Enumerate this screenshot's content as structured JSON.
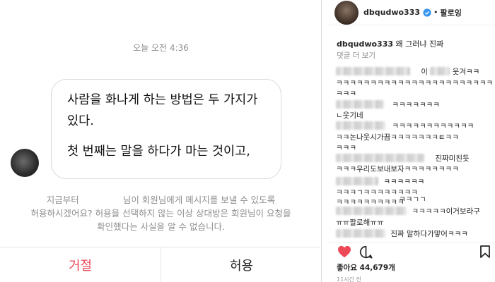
{
  "dm": {
    "timestamp": "오늘 오전 4:36",
    "message_lines": [
      "사람을 화나게 하는 방법은 두 가지가",
      "있다.",
      "첫 번째는 말을 하다가 마는 것이고,"
    ],
    "request_text_1": "지금부터",
    "request_text_2": "님이 회원님에게 메시지를 보낼 수 있도록",
    "request_text_3": "허용하시겠어요? 허용을 선택하지 않는 이상 상대방은 회원님이 요청을",
    "request_text_4": "확인했다는 사실을 알 수 없습니다.",
    "decline_label": "거절",
    "accept_label": "허용"
  },
  "post": {
    "username": "dbqudwo333",
    "follow_label": "팔로잉",
    "caption_user": "dbqudwo333",
    "caption_text": "왜 그러냐 진짜",
    "view_comments": "댓글 더 보기",
    "comments": [
      {
        "visible": "이"
      },
      {
        "visible": "웃겨ㅋㅋ"
      },
      {
        "visible": "ㅋㅋㅋㅋㅋㅋㅋㅋㅋㅋㅋㅋㅋㅋㅋㅋㅋㅋㅋㅋㅋㅋㅋ"
      },
      {
        "visible": "ㅋㅋㅋ"
      },
      {
        "visible": "ㅋㅋㅋㅋㅋㅋㅋ"
      },
      {
        "visible": "ㄴ웃기네"
      },
      {
        "visible": "ㅋㅋㅋㅋㅋㅋㅋㅋㅋㅋㅋㅋ"
      },
      {
        "visible": "ㅋㅋ논나웃시가끔ㅋㅋㅋㅋㅋㅋㅋㅌㅋㅋ"
      },
      {
        "visible": "ㅋㅋㅋ"
      },
      {
        "visible": "진짜미친듯"
      },
      {
        "visible": "ㅋㅋㅋ우리도보내보자ㅋㅋㅋㅋㅋㅋㅋㅋ"
      },
      {
        "visible": "ㅋㅋㅋㅋㅋㅋ"
      },
      {
        "visible": "ㅋㅋㅋㄱㅋㅋㅋㅋㅋㅋㅋㅋ"
      },
      {
        "visible": "ㅋㅋㅋㅋㅋㅋㅋㅋㅋㅋ"
      },
      {
        "visible": "ㅋㅋㄱㄱ"
      },
      {
        "visible": "ㅋㅋㅋㅋㅋ이거보라구"
      },
      {
        "visible": "ㅠㅠ팔로해ㅠㅠ"
      },
      {
        "visible": "진짜 말하다가맣어ㅋㅋㅋ"
      }
    ],
    "likes": "좋아요 44,679개",
    "time_ago": "11시간 전"
  },
  "colors": {
    "decline": "#ed4956",
    "verified": "#3897f0",
    "heart": "#ed4956"
  },
  "icons": [
    "verified-badge-icon",
    "heart-icon",
    "comment-icon",
    "bookmark-icon"
  ]
}
